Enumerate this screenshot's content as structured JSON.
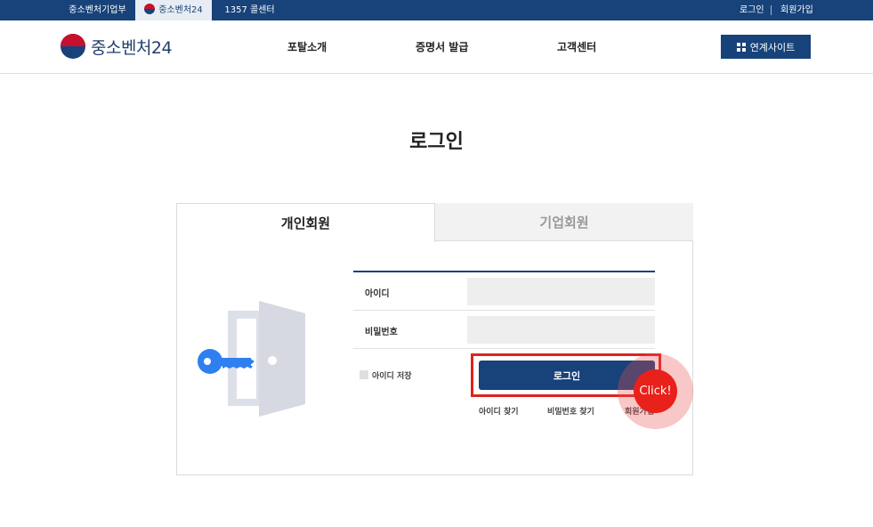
{
  "topbar": {
    "tabs": [
      {
        "label": "중소벤처기업부"
      },
      {
        "label": "중소벤처24"
      },
      {
        "label": "1357 콜센터"
      }
    ],
    "util": {
      "login": "로그인",
      "signup": "회원가입"
    }
  },
  "header": {
    "logo_text": "중소벤처24",
    "nav": [
      "포탈소개",
      "증명서 발급",
      "고객센터"
    ],
    "related_sites": "연계사이트"
  },
  "page": {
    "title": "로그인"
  },
  "login": {
    "tabs": {
      "personal": "개인회원",
      "corporate": "기업회원"
    },
    "id_label": "아이디",
    "id_value": "",
    "password_label": "비밀번호",
    "password_value": "",
    "save_id": "아이디 저장",
    "submit": "로그인",
    "links": [
      "아이디 찾기",
      "비밀번호 찾기",
      "회원가입"
    ]
  },
  "overlay": {
    "click_label": "Click!"
  },
  "colors": {
    "brand_navy": "#17427a",
    "highlight_red": "#e0231c",
    "key_blue": "#2e7ff0"
  }
}
